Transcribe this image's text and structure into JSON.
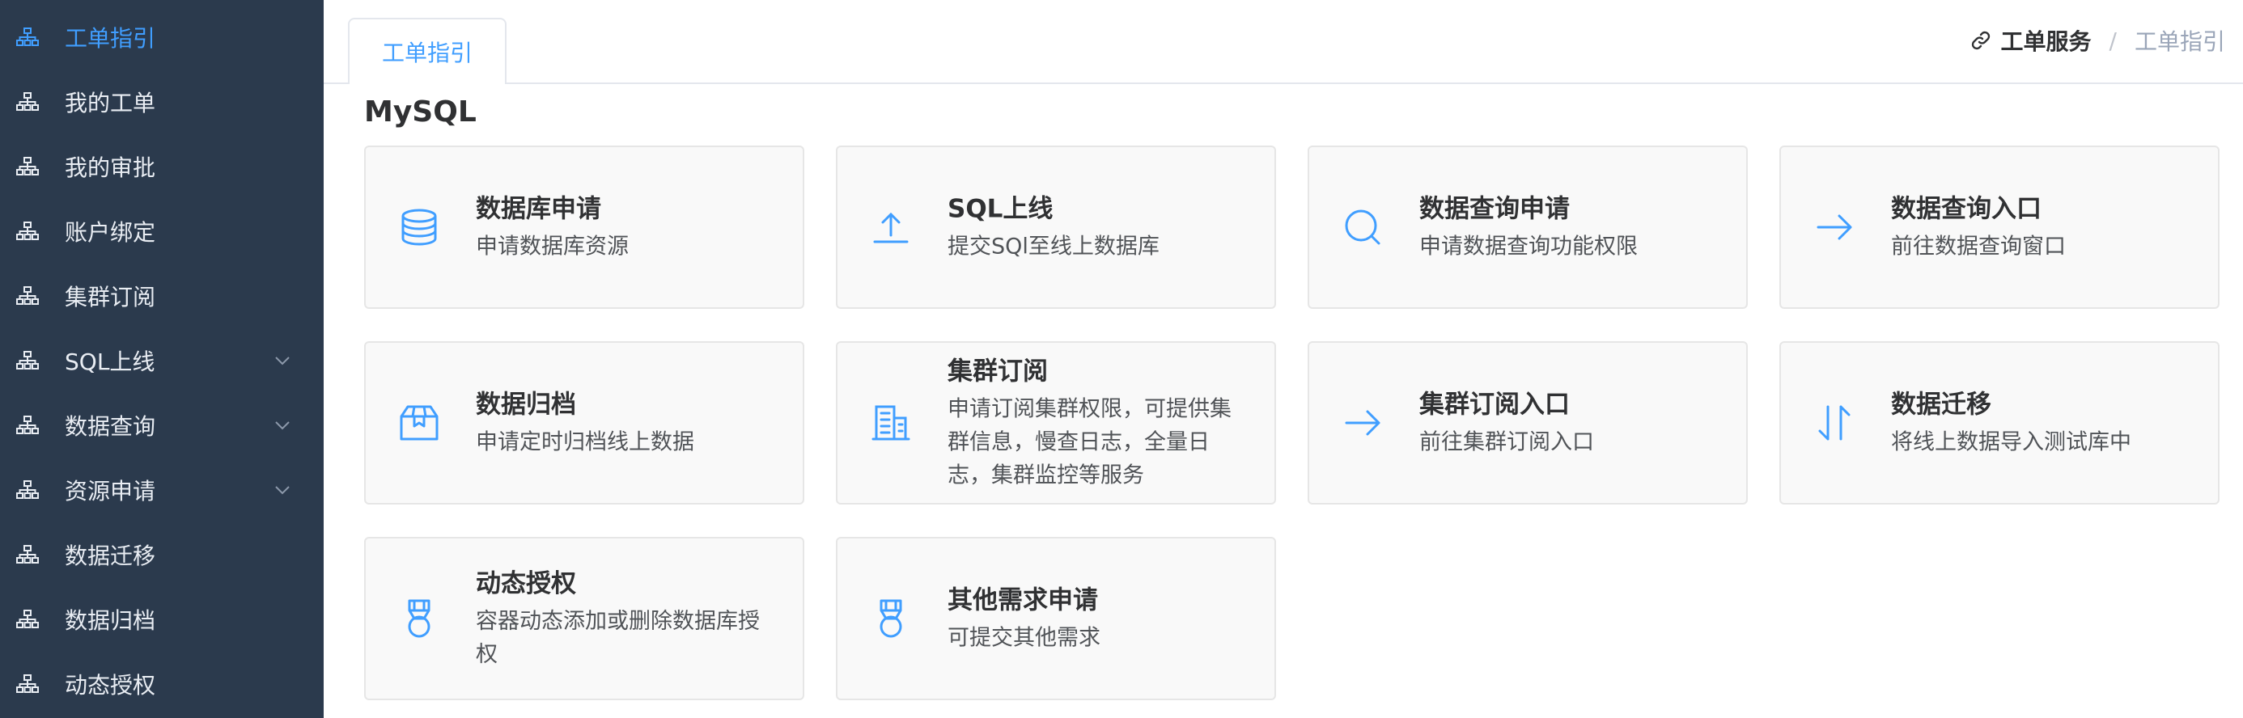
{
  "sidebar": {
    "items": [
      {
        "label": "工单指引",
        "icon": "org-chart-icon",
        "active": true
      },
      {
        "label": "我的工单",
        "icon": "org-chart-icon"
      },
      {
        "label": "我的审批",
        "icon": "org-chart-icon"
      },
      {
        "label": "账户绑定",
        "icon": "org-chart-icon"
      },
      {
        "label": "集群订阅",
        "icon": "org-chart-icon"
      },
      {
        "label": "SQL上线",
        "icon": "org-chart-icon",
        "expandable": true
      },
      {
        "label": "数据查询",
        "icon": "org-chart-icon",
        "expandable": true
      },
      {
        "label": "资源申请",
        "icon": "org-chart-icon",
        "expandable": true
      },
      {
        "label": "数据迁移",
        "icon": "org-chart-icon"
      },
      {
        "label": "数据归档",
        "icon": "org-chart-icon"
      },
      {
        "label": "动态授权",
        "icon": "org-chart-icon"
      }
    ]
  },
  "tabs": [
    {
      "label": "工单指引",
      "active": true
    }
  ],
  "breadcrumb": {
    "icon": "link-icon",
    "first": "工单服务",
    "separator": "/",
    "last": "工单指引"
  },
  "section": {
    "title": "MySQL"
  },
  "cards": [
    {
      "title": "数据库申请",
      "desc": "申请数据库资源",
      "icon": "database-icon"
    },
    {
      "title": "SQL上线",
      "desc": "提交SQl至线上数据库",
      "icon": "upload-icon"
    },
    {
      "title": "数据查询申请",
      "desc": "申请数据查询功能权限",
      "icon": "search-icon"
    },
    {
      "title": "数据查询入口",
      "desc": "前往数据查询窗口",
      "icon": "arrow-right-icon"
    },
    {
      "title": "数据归档",
      "desc": "申请定时归档线上数据",
      "icon": "box-icon"
    },
    {
      "title": "集群订阅",
      "desc": "申请订阅集群权限，可提供集群信息，慢查日志，全量日志，集群监控等服务",
      "icon": "office-building-icon"
    },
    {
      "title": "集群订阅入口",
      "desc": "前往集群订阅入口",
      "icon": "arrow-right-icon"
    },
    {
      "title": "数据迁移",
      "desc": "将线上数据导入测试库中",
      "icon": "sort-arrows-icon"
    },
    {
      "title": "动态授权",
      "desc": "容器动态添加或删除数据库授权",
      "icon": "medal-icon"
    },
    {
      "title": "其他需求申请",
      "desc": "可提交其他需求",
      "icon": "medal-icon"
    }
  ],
  "colors": {
    "sidebar_bg": "#2b3a4d",
    "accent": "#409eff",
    "card_bg": "#f9f9f9"
  }
}
